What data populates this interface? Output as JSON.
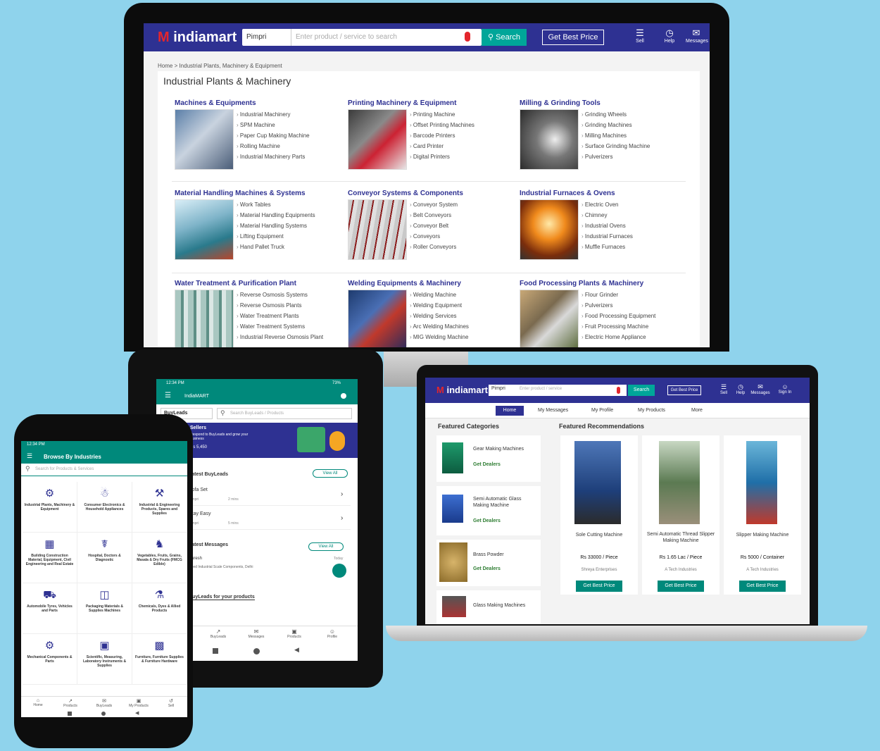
{
  "colors": {
    "background": "#8fd3ec",
    "header": "#2e3192",
    "brand_red": "#e3262c",
    "search_green": "#00a699",
    "app_green": "#00897b"
  },
  "desktop": {
    "logo": "indiamart",
    "search_location": "Pimpri",
    "search_placeholder": "Enter product / service to search",
    "search_button": "Search",
    "best_price_button": "Get Best Price",
    "nav": [
      {
        "icon": "sell-icon",
        "label": "Sell"
      },
      {
        "icon": "help-icon",
        "label": "Help"
      },
      {
        "icon": "messages-icon",
        "label": "Messages"
      }
    ],
    "breadcrumb": "Home > Industrial Plants, Machinery & Equipment",
    "page_title": "Industrial Plants & Machinery",
    "categories": [
      {
        "title": "Machines & Equipments",
        "items": [
          "Industrial Machinery",
          "SPM Machine",
          "Paper Cup Making Machine",
          "Rolling Machine",
          "Industrial Machinery Parts"
        ]
      },
      {
        "title": "Printing Machinery & Equipment",
        "items": [
          "Printing Machine",
          "Offset Printing Machines",
          "Barcode Printers",
          "Card Printer",
          "Digital Printers"
        ]
      },
      {
        "title": "Milling & Grinding Tools",
        "items": [
          "Grinding Wheels",
          "Grinding Machines",
          "Milling Machines",
          "Surface Grinding Machine",
          "Pulverizers"
        ]
      },
      {
        "title": "Material Handling Machines & Systems",
        "items": [
          "Work Tables",
          "Material Handling Equipments",
          "Material Handling Systems",
          "Lifting Equipment",
          "Hand Pallet Truck"
        ]
      },
      {
        "title": "Conveyor Systems & Components",
        "items": [
          "Conveyor System",
          "Belt Conveyors",
          "Conveyor Belt",
          "Conveyors",
          "Roller Conveyors"
        ]
      },
      {
        "title": "Industrial Furnaces & Ovens",
        "items": [
          "Electric Oven",
          "Chimney",
          "Industrial Ovens",
          "Industrial Furnaces",
          "Muffle Furnaces"
        ]
      },
      {
        "title": "Water Treatment & Purification Plant",
        "items": [
          "Reverse Osmosis Systems",
          "Reverse Osmosis Plants",
          "Water Treatment Plants",
          "Water Treatment Systems",
          "Industrial Reverse Osmosis Plant"
        ]
      },
      {
        "title": "Welding Equipments & Machinery",
        "items": [
          "Welding Machine",
          "Welding Equipment",
          "Welding Services",
          "Arc Welding Machines",
          "MIG Welding Machine"
        ]
      },
      {
        "title": "Food Processing Plants & Machinery",
        "items": [
          "Flour Grinder",
          "Pulverizers",
          "Food Processing Equipment",
          "Fruit Processing Machine",
          "Electric Home Appliance"
        ]
      }
    ]
  },
  "laptop": {
    "logo": "indiamart",
    "search_location": "Pimpri",
    "search_placeholder": "Enter product / service",
    "search_button": "Search",
    "best_price_button": "Get Best Price",
    "nav": [
      "Sell",
      "Help",
      "Messages",
      "Sign In"
    ],
    "tabs": [
      "Home",
      "My Messages",
      "My Profile",
      "My Products",
      "More"
    ],
    "featured_categories_title": "Featured Categories",
    "featured_categories": [
      {
        "name": "Gear Making Machines",
        "link": "Get Dealers"
      },
      {
        "name": "Semi Automatic Glass Making Machine",
        "link": "Get Dealers"
      },
      {
        "name": "Brass Powder",
        "link": "Get Dealers"
      },
      {
        "name": "Glass Making Machines",
        "link": ""
      }
    ],
    "recommendations_title": "Featured Recommendations",
    "products": [
      {
        "name": "Sole Cutting Machine",
        "price": "Rs 33000 / Piece",
        "seller": "Shreya Enterprises",
        "button": "Get Best Price"
      },
      {
        "name": "Semi Automatic Thread Slipper Making Machine",
        "price": "Rs 1.65 Lac / Piece",
        "seller": "A Tech Industries",
        "button": "Get Best Price"
      },
      {
        "name": "Slipper Making Machine",
        "price": "Rs 5000 / Container",
        "seller": "A Tech Industries",
        "button": "Get Best Price"
      }
    ]
  },
  "tablet": {
    "status_time": "12:34 PM",
    "status_battery": "73%",
    "toolbar_title": "IndiaMART",
    "filter_label": "BuyLeads",
    "search_placeholder": "Search BuyLeads / Products",
    "banner_title": "Sellers",
    "banner_text": "Respond to BuyLeads and grow your business",
    "banner_sub": "Rs 5,450",
    "latest_title": "Latest BuyLeads",
    "view_all": "View All",
    "leads": [
      {
        "title": "Sofa Set",
        "meta": "Pimpri",
        "time": "2 mins"
      },
      {
        "title": "Stay Easy",
        "meta": "Pimpri",
        "time": "5 mins"
      }
    ],
    "messages_title": "Latest Messages",
    "message_name": "Suresh",
    "message_text": "Need Industrial Scale Components, Delhi",
    "message_date": "Today",
    "products_title": "BuyLeads for your products",
    "bottom_nav": [
      "Home",
      "BuyLeads",
      "Messages",
      "Products",
      "Profile"
    ]
  },
  "phone": {
    "status_time": "12:34 PM",
    "toolbar_title": "Browse By Industries",
    "search_placeholder": "Search for Products & Services",
    "tiles": [
      {
        "icon": "tower-icon",
        "label": "Industrial Plants, Machinery & Equipment"
      },
      {
        "icon": "electronics-icon",
        "label": "Consumer Electronics & Household Appliances"
      },
      {
        "icon": "engineering-icon",
        "label": "Industrial & Engineering Products, Spares and Supplies"
      },
      {
        "icon": "building-icon",
        "label": "Building Construction Material, Equipment, Civil Engineering and Real Estate"
      },
      {
        "icon": "doctor-icon",
        "label": "Hospital, Doctors & Diagnostic"
      },
      {
        "icon": "food-icon",
        "label": "Vegetables, Fruits, Grains, Masala & Dry Fruits (FMCG Edible)"
      },
      {
        "icon": "vehicle-icon",
        "label": "Automobile Tyres, Vehicles and Parts"
      },
      {
        "icon": "pharma-icon",
        "label": "Packaging Materials & Supplies Machines"
      },
      {
        "icon": "chemical-icon",
        "label": "Chemicals, Dyes & Allied Products"
      },
      {
        "icon": "gear-icon",
        "label": "Mechanical Components & Parts"
      },
      {
        "icon": "meter-icon",
        "label": "Scientific, Measuring, Laboratory Instruments & Supplies"
      },
      {
        "icon": "furniture-icon",
        "label": "Furniture, Furniture Supplies & Furniture Hardware"
      }
    ],
    "bottom_nav": [
      "Home",
      "Products",
      "BuyLeads",
      "My Products",
      "Sell"
    ]
  }
}
